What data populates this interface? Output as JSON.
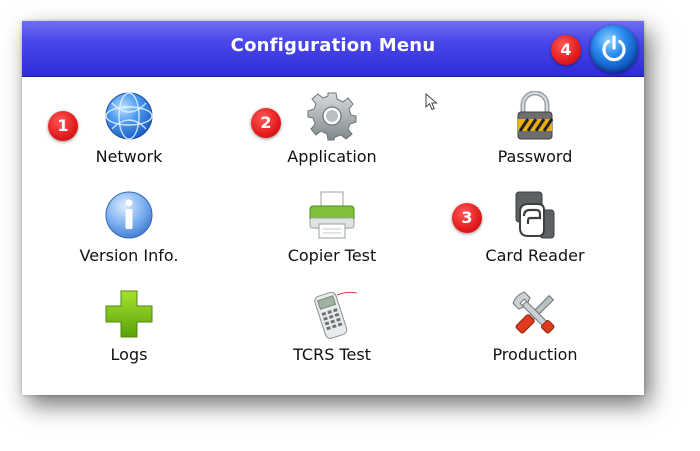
{
  "window": {
    "title": "Configuration Menu"
  },
  "header": {
    "power_icon": "power-icon",
    "accent_gradient": [
      "#6f6ef2",
      "#2e2bd8"
    ]
  },
  "menu_items": [
    {
      "label": "Network",
      "icon": "globe-icon"
    },
    {
      "label": "Application",
      "icon": "gear-icon"
    },
    {
      "label": "Password",
      "icon": "padlock-icon"
    },
    {
      "label": "Version Info.",
      "icon": "info-icon"
    },
    {
      "label": "Copier Test",
      "icon": "printer-icon"
    },
    {
      "label": "Card Reader",
      "icon": "card-reader-icon"
    },
    {
      "label": "Logs",
      "icon": "plus-icon"
    },
    {
      "label": "TCRS Test",
      "icon": "card-terminal-icon"
    },
    {
      "label": "Production",
      "icon": "tools-icon"
    }
  ],
  "callouts": [
    "1",
    "2",
    "3",
    "4"
  ],
  "colors": {
    "callout_red": "#e21b1b",
    "power_blue": "#2a8bef",
    "plus_green": "#7ac70c",
    "info_blue": "#5b9be8"
  }
}
